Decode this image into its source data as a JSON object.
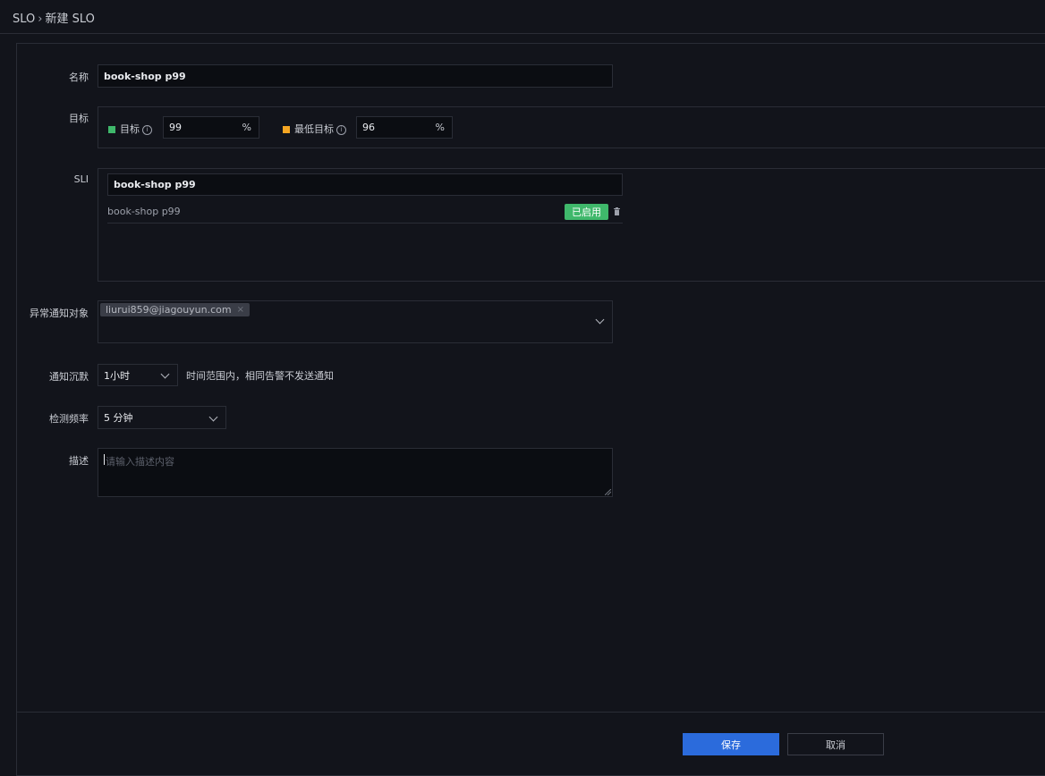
{
  "breadcrumb": {
    "root": "SLO",
    "separator": "›",
    "current": "新建 SLO"
  },
  "form": {
    "name": {
      "label": "名称",
      "value": "book-shop p99"
    },
    "target": {
      "label": "目标",
      "goal": {
        "label": "目标",
        "value": "99",
        "unit": "%",
        "color": "#3fb86b"
      },
      "min_goal": {
        "label": "最低目标",
        "value": "96",
        "unit": "%",
        "color": "#f5a623"
      },
      "info_glyph": "i"
    },
    "sli": {
      "label": "SLI",
      "search_value": "book-shop p99",
      "items": [
        {
          "name": "book-shop p99",
          "status": "已启用"
        }
      ],
      "delete_icon": "trash-icon"
    },
    "notify_target": {
      "label": "异常通知对象",
      "tags": [
        "liurui859@jiagouyun.com"
      ],
      "tag_close": "×"
    },
    "silence": {
      "label": "通知沉默",
      "value": "1小时",
      "hint": "时间范围内，相同告警不发送通知"
    },
    "frequency": {
      "label": "检测频率",
      "value": "5 分钟"
    },
    "description": {
      "label": "描述",
      "placeholder": "请输入描述内容"
    }
  },
  "footer": {
    "save_label": "保存",
    "cancel_label": "取消"
  },
  "colors": {
    "primary": "#2b6bdc",
    "success": "#3fb86b",
    "warning": "#f5a623"
  }
}
